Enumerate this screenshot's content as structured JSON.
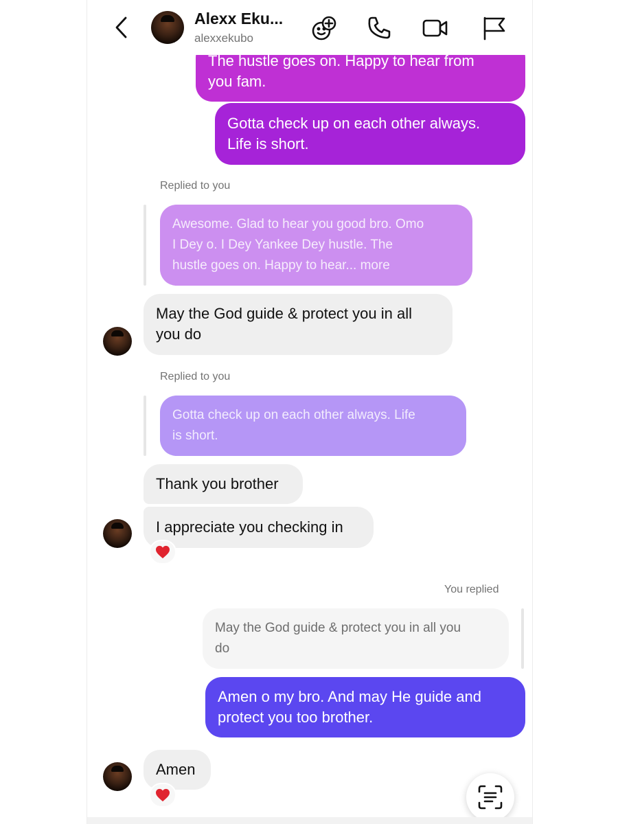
{
  "header": {
    "back_icon": "chevron-left-icon",
    "contact_name": "Alexx Eku...",
    "username": "alexxekubo",
    "icons": [
      "add-sticker-icon",
      "phone-icon",
      "video-camera-icon",
      "flag-icon"
    ]
  },
  "colors": {
    "outgoing_purple_top": "#c12fd1",
    "outgoing_purple_mid": "#9b22d8",
    "outgoing_blue": "#5b47f0",
    "quote_purple_light": "#cc8ff0",
    "quote_purple_lighter": "#b596f6",
    "incoming_gray": "#efefef",
    "reaction_heart": "#e0242f"
  },
  "messages": {
    "out1_line1": "The hustle goes on.   Happy to hear from",
    "out1_line2": "you fam.",
    "out2_line1": "Gotta check up on each other always.",
    "out2_line2": "Life is short.",
    "replied_label_1": "Replied to you",
    "quote1_line1": "Awesome. Glad to hear you good bro.  Omo",
    "quote1_line2": "I Dey o.  I Dey Yankee Dey hustle.  The",
    "quote1_line3": "hustle goes on.   Happy to hear... more",
    "in1_line1": "May the God guide & protect you in all",
    "in1_line2": "you do",
    "replied_label_2": "Replied to you",
    "quote2_line1": "Gotta check up on each other always.  Life",
    "quote2_line2": "is short.",
    "in2": "Thank you brother",
    "in3": "I appreciate you checking in",
    "reaction1": "heart",
    "you_replied_label": "You replied",
    "quote3_line1": "May the God guide & protect you in all you",
    "quote3_line2": "do",
    "out3_line1": "Amen o my bro.  And may He guide and",
    "out3_line2": "protect you too brother.",
    "in4": "Amen",
    "reaction2": "heart"
  },
  "scan_button_icon": "scan-text-icon"
}
